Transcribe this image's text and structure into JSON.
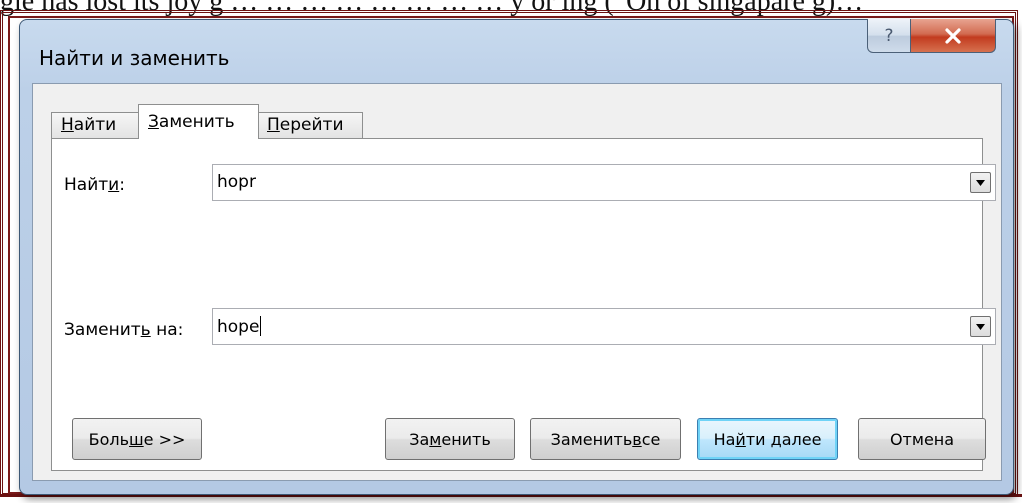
{
  "background": {
    "doc_text": "gle has lost its joy g … … … … … … … … y or ing (“Oh of singapare g)…"
  },
  "dialog": {
    "title": "Найти и заменить",
    "help_glyph": "?",
    "tabs": [
      {
        "pre": "",
        "key": "Н",
        "post": "айти",
        "active": false
      },
      {
        "pre": "",
        "key": "З",
        "post": "аменить",
        "active": true
      },
      {
        "pre": "",
        "key": "П",
        "post": "ерейти",
        "active": false
      }
    ],
    "find": {
      "label_pre": "Найт",
      "label_key": "и",
      "label_post": ":",
      "value": "hopr"
    },
    "replace": {
      "label_pre": "Заменит",
      "label_key": "ь",
      "label_post": " на:",
      "value": "hope"
    },
    "buttons": {
      "more": {
        "pre": "Боль",
        "key": "ш",
        "post": "е >>"
      },
      "replace": {
        "pre": "За",
        "key": "м",
        "post": "енить"
      },
      "replace_all": {
        "pre": "Заменить ",
        "key": "в",
        "post": "се"
      },
      "find_next": {
        "pre": "На",
        "key": "й",
        "post": "ти далее"
      },
      "cancel": {
        "pre": "Отмена",
        "key": "",
        "post": ""
      }
    }
  },
  "colors": {
    "window_frame": "#b4c9e4",
    "close_button": "#c94a2c",
    "default_button_border": "#3c7fb1"
  }
}
